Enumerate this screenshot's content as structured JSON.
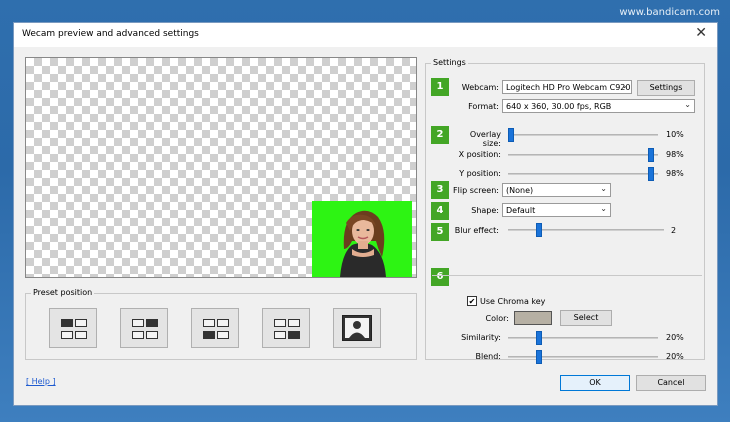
{
  "watermark": "www.bandicam.com",
  "window": {
    "title": "Wecam preview and advanced settings",
    "close_glyph": "✕"
  },
  "preset": {
    "group_label": "Preset position",
    "buttons": [
      {
        "name": "top-left",
        "active": [
          0
        ]
      },
      {
        "name": "top-right",
        "active": [
          1
        ]
      },
      {
        "name": "bottom-left",
        "active": [
          2
        ]
      },
      {
        "name": "bottom-right",
        "active": [
          3
        ]
      },
      {
        "name": "full",
        "active": []
      }
    ]
  },
  "settings": {
    "group_label": "Settings",
    "steps": [
      "1",
      "2",
      "3",
      "4",
      "5",
      "6"
    ],
    "webcam": {
      "label": "Webcam:",
      "value": "Logitech HD Pro Webcam C920",
      "button": "Settings"
    },
    "format": {
      "label": "Format:",
      "value": "640 x 360, 30.00 fps, RGB"
    },
    "overlay_size": {
      "label": "Overlay size:",
      "value": "10%",
      "level": 0.1
    },
    "x_position": {
      "label": "X position:",
      "value": "98%",
      "level": 0.98
    },
    "y_position": {
      "label": "Y position:",
      "value": "98%",
      "level": 0.98
    },
    "flip_screen": {
      "label": "Flip screen:",
      "value": "(None)"
    },
    "shape": {
      "label": "Shape:",
      "value": "Default"
    },
    "blur_effect": {
      "label": "Blur effect:",
      "value": "2",
      "level": 0.2
    },
    "chroma": {
      "checkbox_label": "Use Chroma key",
      "checked": true,
      "color_label": "Color:",
      "color_hex": "#b6b0a4",
      "select_button": "Select",
      "similarity": {
        "label": "Similarity:",
        "value": "20%",
        "level": 0.2
      },
      "blend": {
        "label": "Blend:",
        "value": "20%",
        "level": 0.2
      }
    }
  },
  "footer": {
    "help": "[ Help ]",
    "ok": "OK",
    "cancel": "Cancel"
  },
  "colors": {
    "accent_green": "#43a626",
    "chroma_green": "#2df413",
    "slider_thumb": "#1a73d9"
  }
}
